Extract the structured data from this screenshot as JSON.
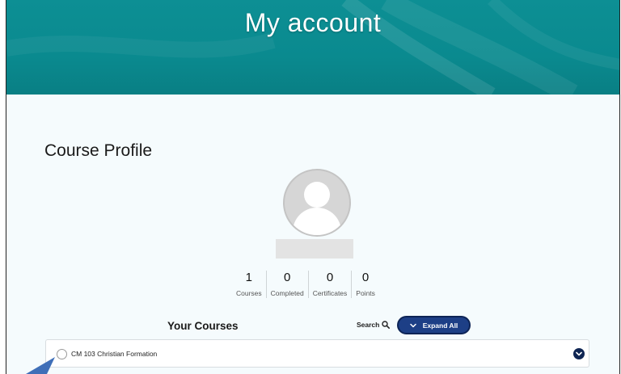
{
  "header": {
    "title": "My account",
    "banner_color": "#0a8a8f"
  },
  "profile": {
    "section_title": "Course Profile",
    "avatar_icon": "user-avatar-icon"
  },
  "stats": [
    {
      "value": "1",
      "label": "Courses"
    },
    {
      "value": "0",
      "label": "Completed"
    },
    {
      "value": "0",
      "label": "Certificates"
    },
    {
      "value": "0",
      "label": "Points"
    }
  ],
  "courses_section": {
    "title": "Your Courses",
    "search_label": "Search",
    "search_icon": "search-icon",
    "expand_all_label": "Expand All",
    "expand_button_color": "#1d3f86"
  },
  "courses": [
    {
      "name": "CM 103 Christian Formation"
    }
  ],
  "annotation": {
    "arrow_color": "#3f6fb8"
  }
}
